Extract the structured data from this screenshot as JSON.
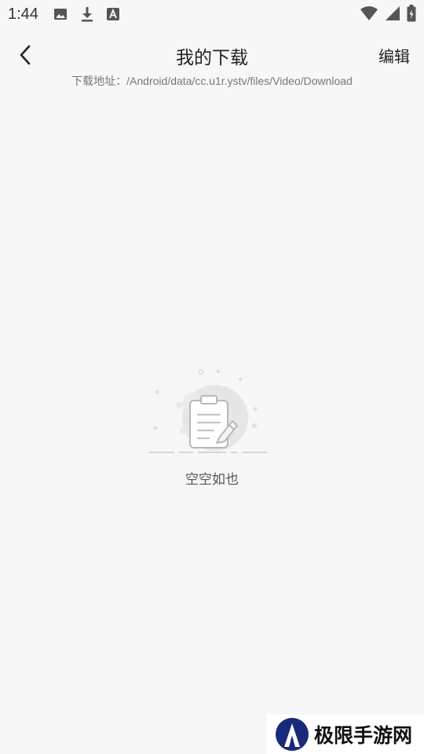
{
  "status_bar": {
    "time": "1:44",
    "left_icons": [
      "image-icon",
      "download-icon",
      "font-icon"
    ],
    "right_icons": [
      "wifi-icon",
      "signal-icon",
      "battery-icon"
    ]
  },
  "header": {
    "back_icon": "chevron-left-icon",
    "title": "我的下载",
    "edit_label": "编辑"
  },
  "download_path": "下载地址：/Android/data/cc.u1r.ystv/files/Video/Download",
  "empty_state": {
    "icon": "empty-clipboard-icon",
    "text": "空空如也"
  },
  "watermark": {
    "text": "极限手游网"
  },
  "colors": {
    "background": "#f7f7f7",
    "text_primary": "#222222",
    "text_secondary": "#777777",
    "watermark_logo": "#1a2a7a"
  }
}
